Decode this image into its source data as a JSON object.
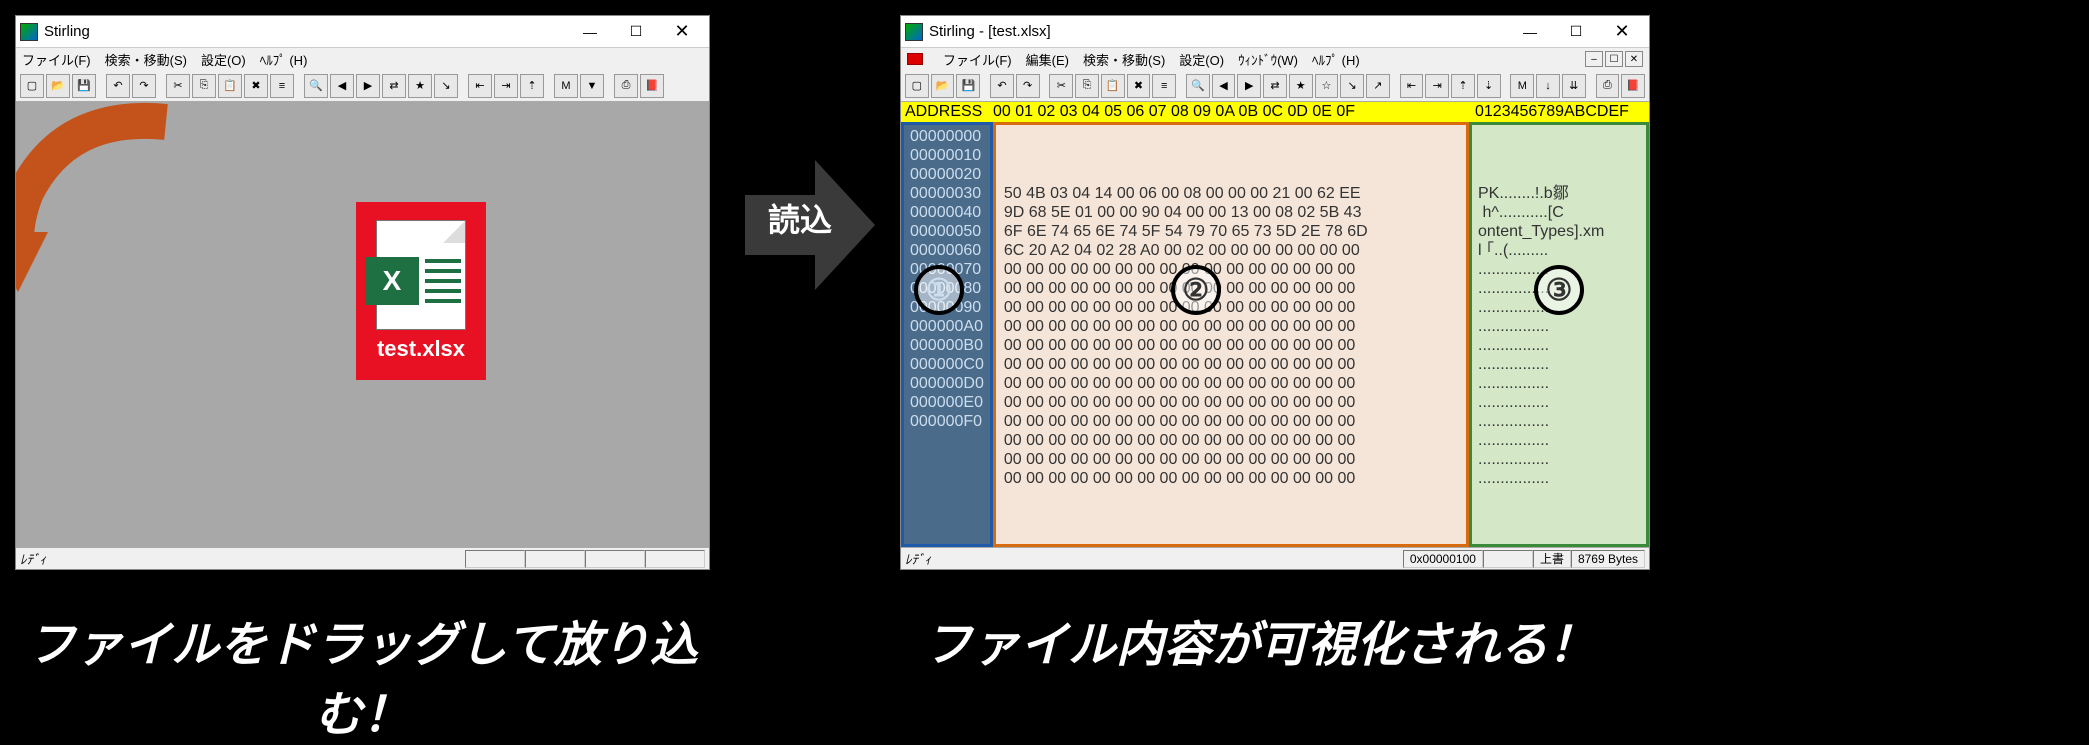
{
  "left_window": {
    "title": "Stirling",
    "menu": [
      "ファイル(F)",
      "検索・移動(S)",
      "設定(O)",
      "ﾍﾙﾌﾟ (H)"
    ],
    "status": "ﾚﾃﾞｨ",
    "drop_file": "test.xlsx"
  },
  "right_window": {
    "title": "Stirling - [test.xlsx]",
    "menu": [
      "ファイル(F)",
      "編集(E)",
      "検索・移動(S)",
      "設定(O)",
      "ｳｨﾝﾄﾞｳ(W)",
      "ﾍﾙﾌﾟ (H)"
    ],
    "header_addr": "ADDRESS",
    "header_hex": "00 01 02 03 04 05 06 07 08 09 0A 0B 0C 0D 0E 0F",
    "header_ascii": "0123456789ABCDEF",
    "addresses": [
      "00000000",
      "00000010",
      "00000020",
      "00000030",
      "00000040",
      "00000050",
      "00000060",
      "00000070",
      "00000080",
      "00000090",
      "000000A0",
      "000000B0",
      "000000C0",
      "000000D0",
      "000000E0",
      "000000F0"
    ],
    "hex_rows": [
      "50 4B 03 04 14 00 06 00 08 00 00 00 21 00 62 EE",
      "9D 68 5E 01 00 00 90 04 00 00 13 00 08 02 5B 43",
      "6F 6E 74 65 6E 74 5F 54 79 70 65 73 5D 2E 78 6D",
      "6C 20 A2 04 02 28 A0 00 02 00 00 00 00 00 00 00",
      "00 00 00 00 00 00 00 00 00 00 00 00 00 00 00 00",
      "00 00 00 00 00 00 00 00 00 00 00 00 00 00 00 00",
      "00 00 00 00 00 00 00 00 00 00 00 00 00 00 00 00",
      "00 00 00 00 00 00 00 00 00 00 00 00 00 00 00 00",
      "00 00 00 00 00 00 00 00 00 00 00 00 00 00 00 00",
      "00 00 00 00 00 00 00 00 00 00 00 00 00 00 00 00",
      "00 00 00 00 00 00 00 00 00 00 00 00 00 00 00 00",
      "00 00 00 00 00 00 00 00 00 00 00 00 00 00 00 00",
      "00 00 00 00 00 00 00 00 00 00 00 00 00 00 00 00",
      "00 00 00 00 00 00 00 00 00 00 00 00 00 00 00 00",
      "00 00 00 00 00 00 00 00 00 00 00 00 00 00 00 00",
      "00 00 00 00 00 00 00 00 00 00 00 00 00 00 00 00"
    ],
    "ascii_rows": [
      "PK........!.b鄒",
      " h^...........[C",
      "ontent_Types].xm",
      "l ｢..(.........",
      "................",
      "................",
      "................",
      "................",
      "................",
      "................",
      "................",
      "................",
      "................",
      "................",
      "................",
      "................"
    ],
    "status_ready": "ﾚﾃﾞｨ",
    "status_offset": "0x00000100",
    "status_mode": "上書",
    "status_size": "8769 Bytes"
  },
  "arrow_label": "読込",
  "circles": {
    "c1": "①",
    "c2": "②",
    "c3": "③"
  },
  "captions": {
    "left": "ファイルをドラッグして放り込む！",
    "right": "ファイル内容が可視化される！"
  },
  "toolbar_icons": [
    "new",
    "open",
    "save",
    "sep",
    "undo",
    "redo",
    "sep",
    "cut",
    "copy",
    "paste",
    "delete",
    "insert",
    "sep",
    "find",
    "find-prev",
    "find-next",
    "replace",
    "mark",
    "go",
    "sep",
    "nav-prev",
    "nav-next",
    "nav-up",
    "sep",
    "mask",
    "sel",
    "sep",
    "print",
    "help"
  ],
  "toolbar_icons_right": [
    "new",
    "open",
    "save",
    "sep",
    "undo",
    "redo",
    "sep",
    "cut",
    "copy",
    "paste",
    "delete",
    "insert",
    "sep",
    "find",
    "find-prev",
    "find-next",
    "replace",
    "mark",
    "mark2",
    "go",
    "go2",
    "sep",
    "nav-prev",
    "nav-next",
    "nav-up",
    "nav-down",
    "sep",
    "mask",
    "down1",
    "down2",
    "sep",
    "print",
    "help"
  ]
}
